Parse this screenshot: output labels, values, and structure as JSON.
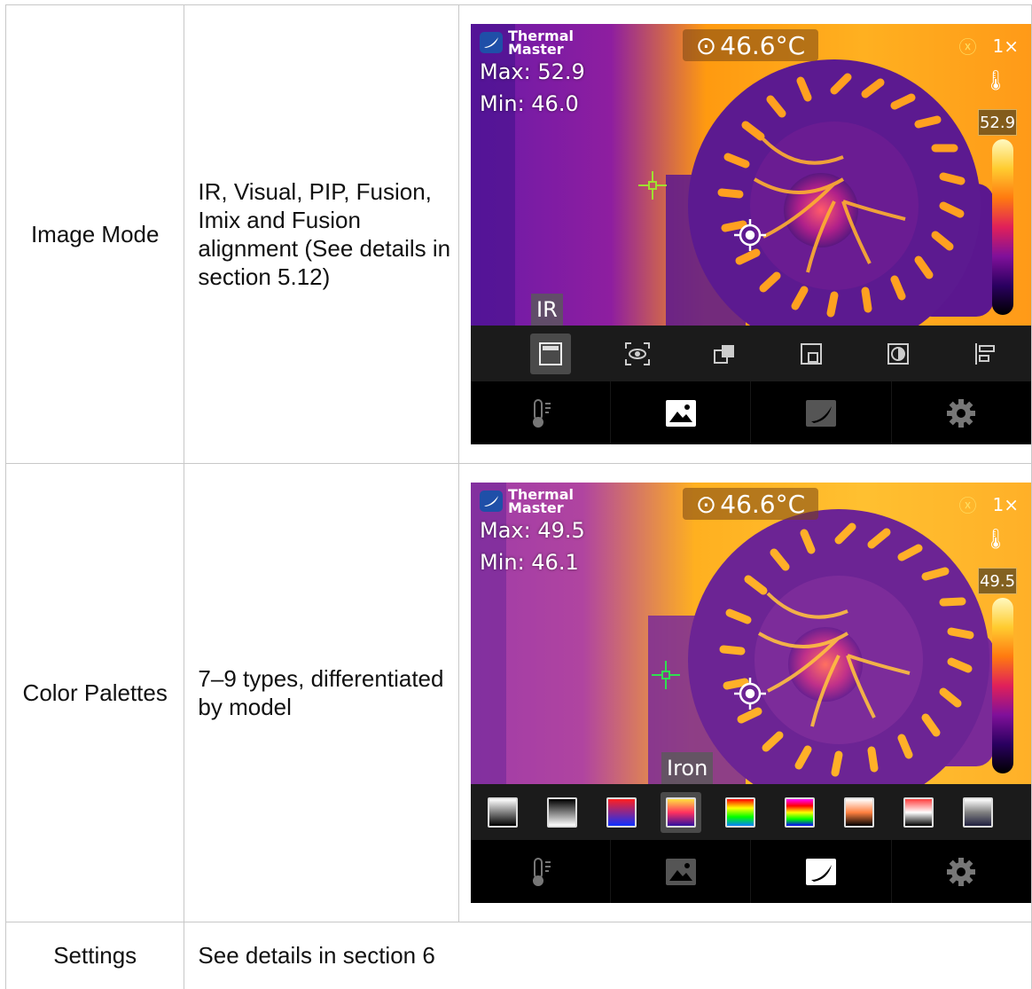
{
  "rows": [
    {
      "feature": "Image Mode",
      "description": "IR, Visual, PIP, Fusion, Imix and Fusion alignment (See details in section 5.12)",
      "screen": {
        "brand_line1": "Thermal",
        "brand_line2": "Master",
        "max": "Max: 52.9",
        "min": "Min: 46.0",
        "center_temp": "46.6°C",
        "zoom": "1×",
        "scale_max": "52.9",
        "mode_label": "IR",
        "tools": [
          "ir-mode-icon",
          "visual-mode-icon",
          "pip-mode-icon",
          "fusion-mode-icon",
          "imix-mode-icon",
          "alignment-icon"
        ],
        "selected_tool": 0,
        "nav": [
          "thermometer-icon",
          "image-icon",
          "palette-icon",
          "gear-icon"
        ],
        "active_nav": 1
      }
    },
    {
      "feature": "Color Palettes",
      "description": "7–9 types, differentiated by model",
      "screen": {
        "brand_line1": "Thermal",
        "brand_line2": "Master",
        "max": "Max: 49.5",
        "min": "Min: 46.1",
        "center_temp": "46.6°C",
        "zoom": "1×",
        "scale_max": "49.5",
        "mode_label": "Iron",
        "palettes": [
          {
            "icon": "white-hot-palette-icon",
            "gradient": [
              "#ffffff",
              "#000000"
            ]
          },
          {
            "icon": "black-hot-palette-icon",
            "gradient": [
              "#000000",
              "#ffffff"
            ]
          },
          {
            "icon": "red-blue-palette-icon",
            "gradient": [
              "#ff2020",
              "#1030ff"
            ]
          },
          {
            "icon": "iron-palette-icon",
            "gradient": [
              "#ffe040",
              "#ff3060",
              "#3010a0"
            ]
          },
          {
            "icon": "rainbow-palette-icon",
            "gradient": [
              "#ff0000",
              "#ffff00",
              "#00ff00",
              "#0080ff"
            ]
          },
          {
            "icon": "rainbow-hc-palette-icon",
            "gradient": [
              "#ff00ff",
              "#ff0000",
              "#ffff00",
              "#00ff00",
              "#0000ff"
            ]
          },
          {
            "icon": "sepia-palette-icon",
            "gradient": [
              "#ffffff",
              "#ff8040",
              "#000000"
            ]
          },
          {
            "icon": "red-hot-palette-icon",
            "gradient": [
              "#ff4040",
              "#ffffff",
              "#000000"
            ]
          },
          {
            "icon": "gray-palette-icon",
            "gradient": [
              "#ffffff",
              "#808080",
              "#202040"
            ]
          }
        ],
        "selected_palette": 3,
        "nav": [
          "thermometer-icon",
          "image-icon",
          "palette-icon",
          "gear-icon"
        ],
        "active_nav": 2
      }
    },
    {
      "feature": "Settings",
      "description": "See details in section 6"
    }
  ],
  "colors": {
    "table_border": "#c8c8c8",
    "highlight_box": "#4a4a4a",
    "label_box": "#5a5a5a"
  }
}
